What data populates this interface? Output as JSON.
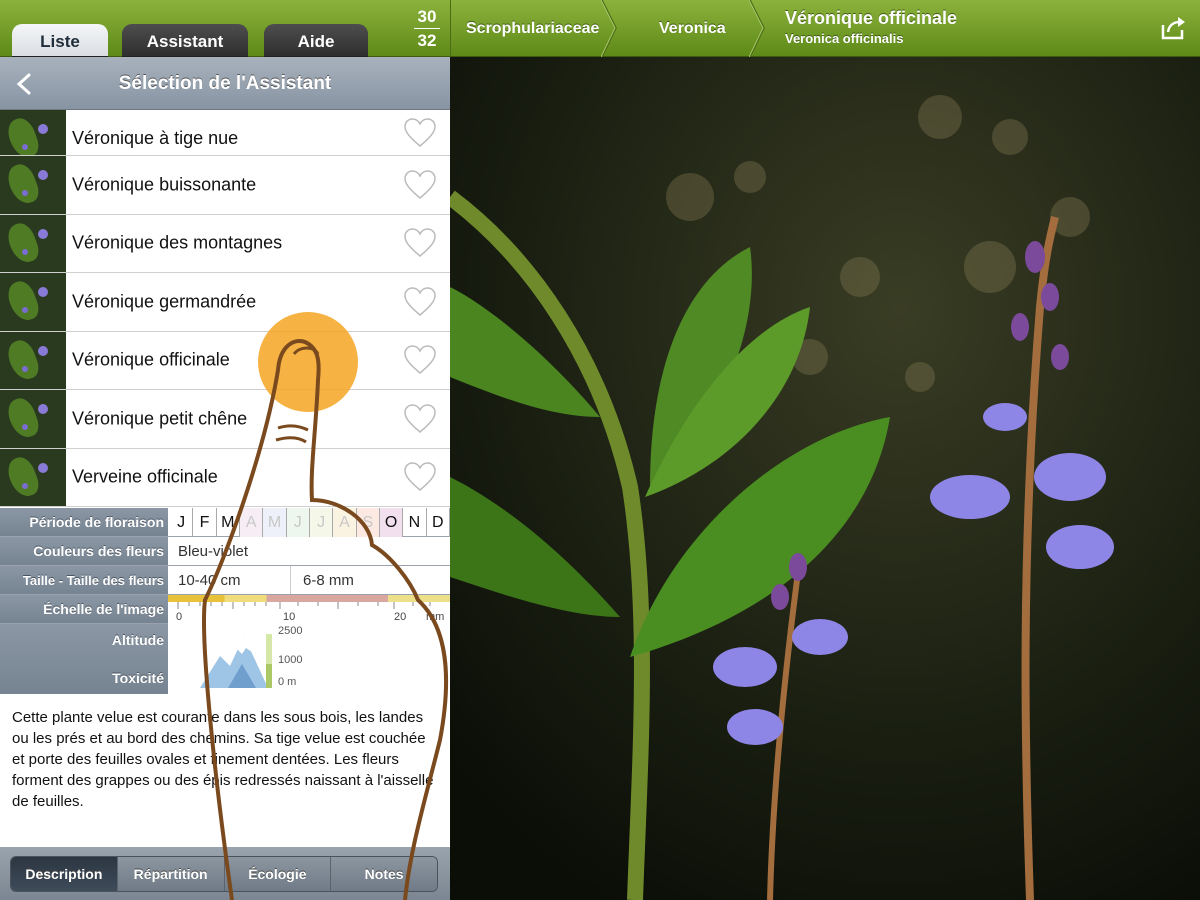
{
  "tabs": {
    "liste": "Liste",
    "assistant": "Assistant",
    "aide": "Aide"
  },
  "counter": {
    "current": "30",
    "total": "32"
  },
  "nav": {
    "title": "Sélection de l'Assistant"
  },
  "list": [
    "Véronique à tige nue",
    "Véronique buissonante",
    "Véronique des montagnes",
    "Véronique germandrée",
    "Véronique officinale",
    "Véronique petit chêne",
    "Verveine officinale"
  ],
  "info": {
    "flowering_label": "Période de floraison",
    "months": [
      "J",
      "F",
      "M",
      "A",
      "M",
      "J",
      "J",
      "A",
      "S",
      "O",
      "N",
      "D"
    ],
    "colors_label": "Couleurs des fleurs",
    "colors_value": "Bleu-violet",
    "size_label": "Taille - Taille des fleurs",
    "size_plant": "10-40 cm",
    "size_flower": "6-8 mm",
    "scale_label": "Échelle de l'image",
    "scale_0": "0",
    "scale_10": "10",
    "scale_20": "20",
    "scale_unit": "mm",
    "altitude_label": "Altitude",
    "toxicity_label": "Toxicité",
    "alt_top": "2500",
    "alt_mid": "1000",
    "alt_bottom": "0 m"
  },
  "description": "Cette plante velue est courante dans les sous bois, les landes ou les prés et au bord des chemins. Sa tige velue est couchée et porte des feuilles ovales et finement dentées. Les fleurs forment des grappes ou des épis redressés naissant à l'aisselle de feuilles.",
  "segments": [
    "Description",
    "Répartition",
    "Écologie",
    "Notes"
  ],
  "breadcrumb": {
    "family": "Scrophulariaceae",
    "genus": "Veronica",
    "species": "Véronique officinale",
    "species_latin": "Veronica officinalis"
  },
  "colors": {
    "green": "#6f9a22",
    "touch": "#f5a623",
    "finger": "#7a4a1e"
  }
}
